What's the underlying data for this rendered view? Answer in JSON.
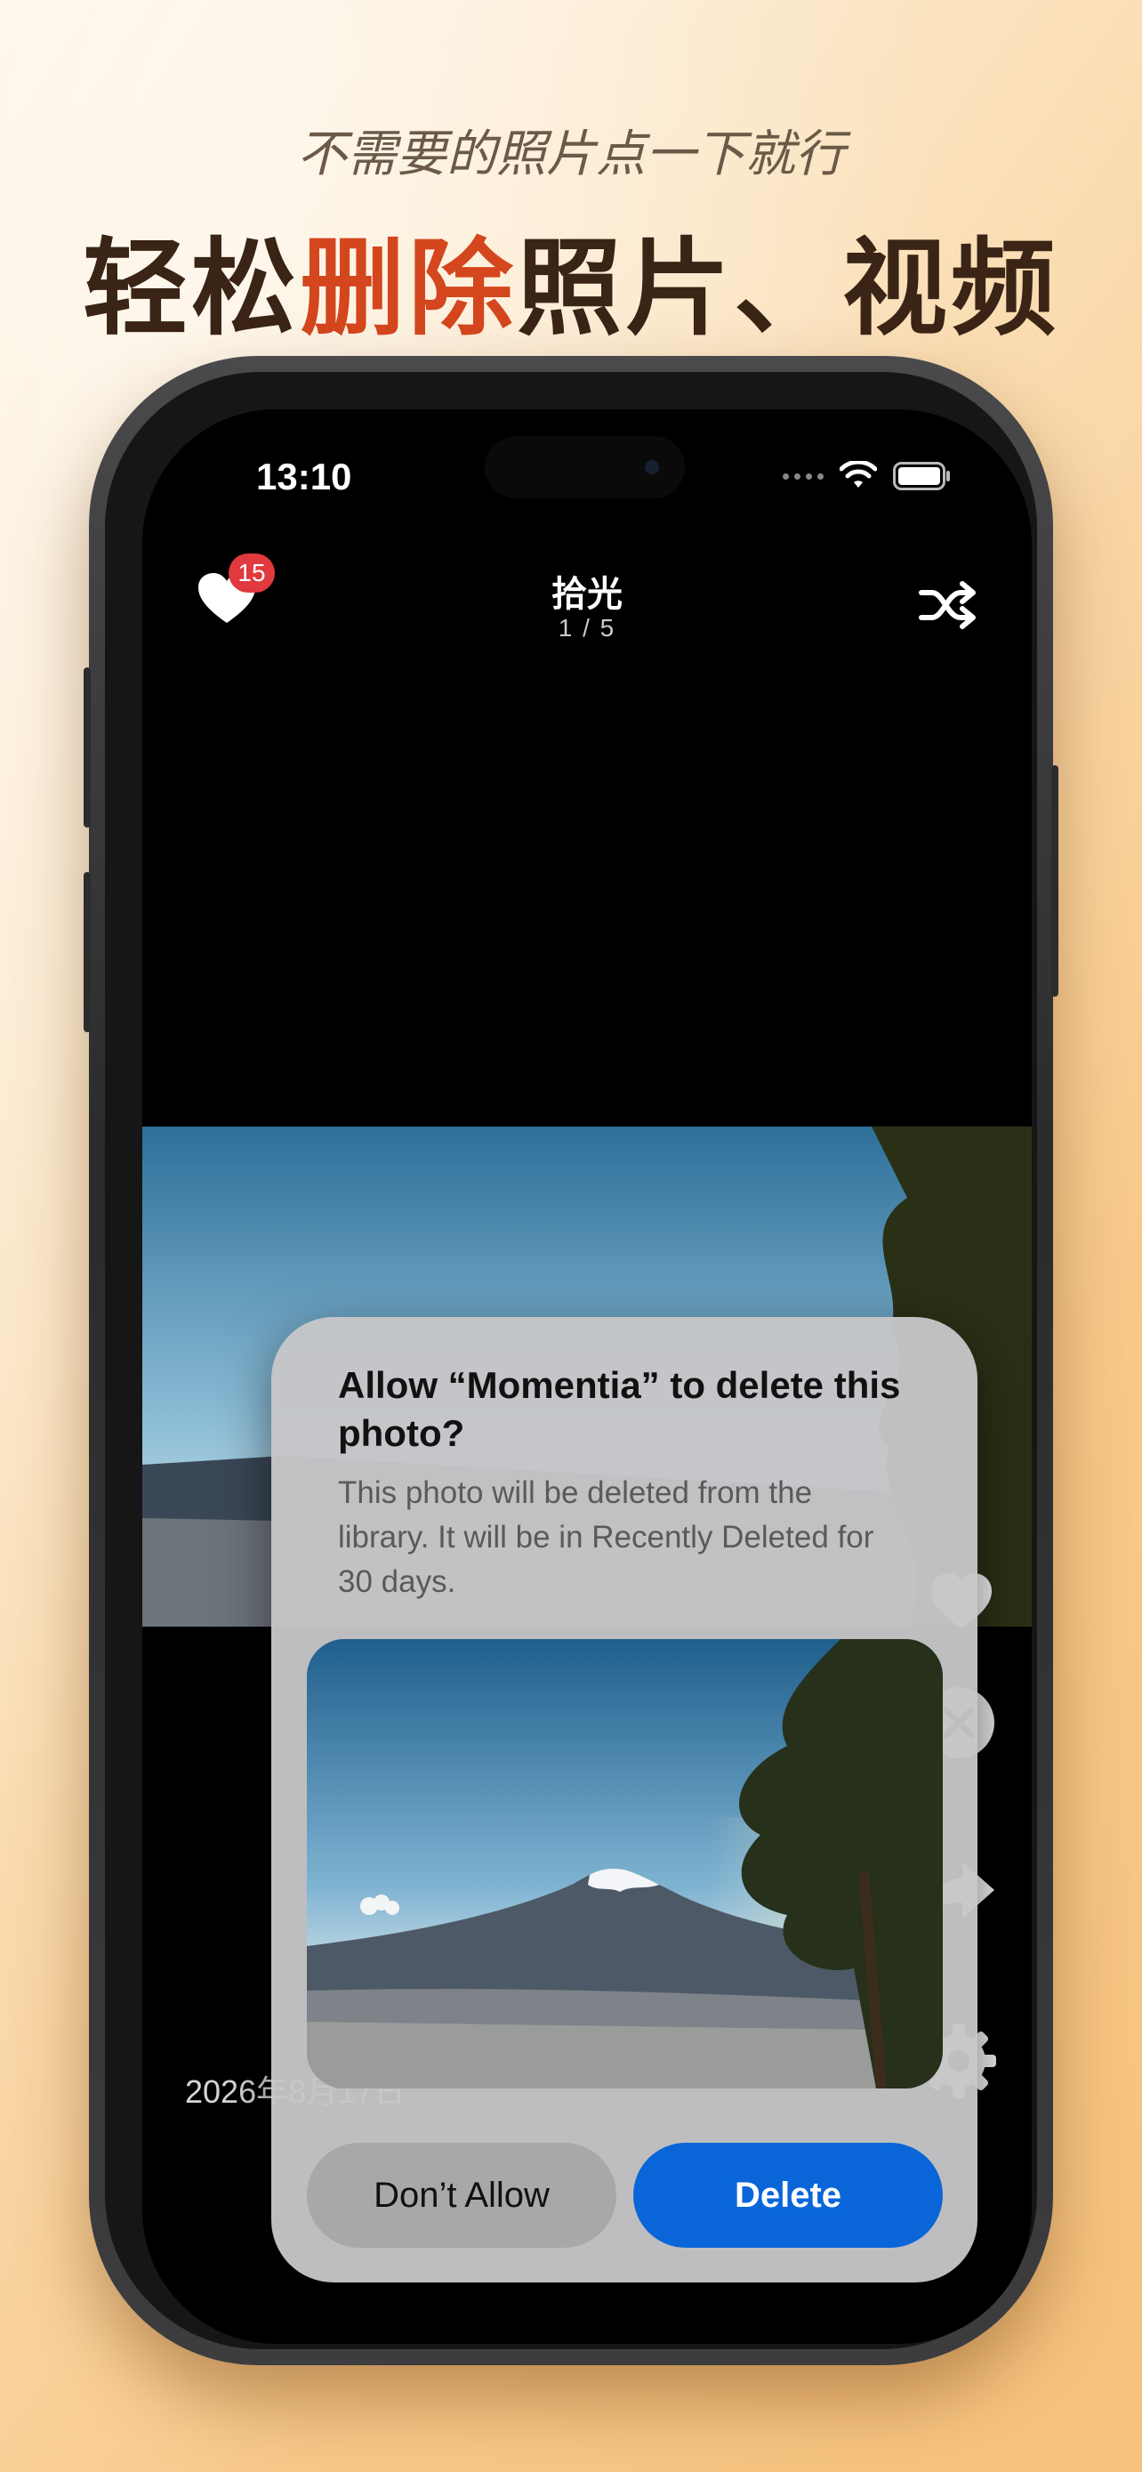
{
  "promo": {
    "subtitle": "不需要的照片点一下就行",
    "headline_pre": "轻松",
    "headline_highlight": "删除",
    "headline_post": "照片、视频",
    "highlight_color": "#d4461e"
  },
  "status_bar": {
    "time": "13:10",
    "icons": [
      "cellular-dots-icon",
      "wifi-icon",
      "battery-icon"
    ]
  },
  "header": {
    "favorites_badge": "15",
    "album_title": "拾光",
    "photo_counter": "1 / 5"
  },
  "photo": {
    "date": "2026年8月17日"
  },
  "actions": [
    "heart-icon",
    "close-icon",
    "share-icon",
    "gear-icon"
  ],
  "alert": {
    "title": "Allow “Momentia” to delete this photo?",
    "message": "This photo will be deleted from the library. It will be in Recently Deleted for 30 days.",
    "deny_label": "Don’t Allow",
    "delete_label": "Delete",
    "delete_color": "#0a66d8"
  }
}
